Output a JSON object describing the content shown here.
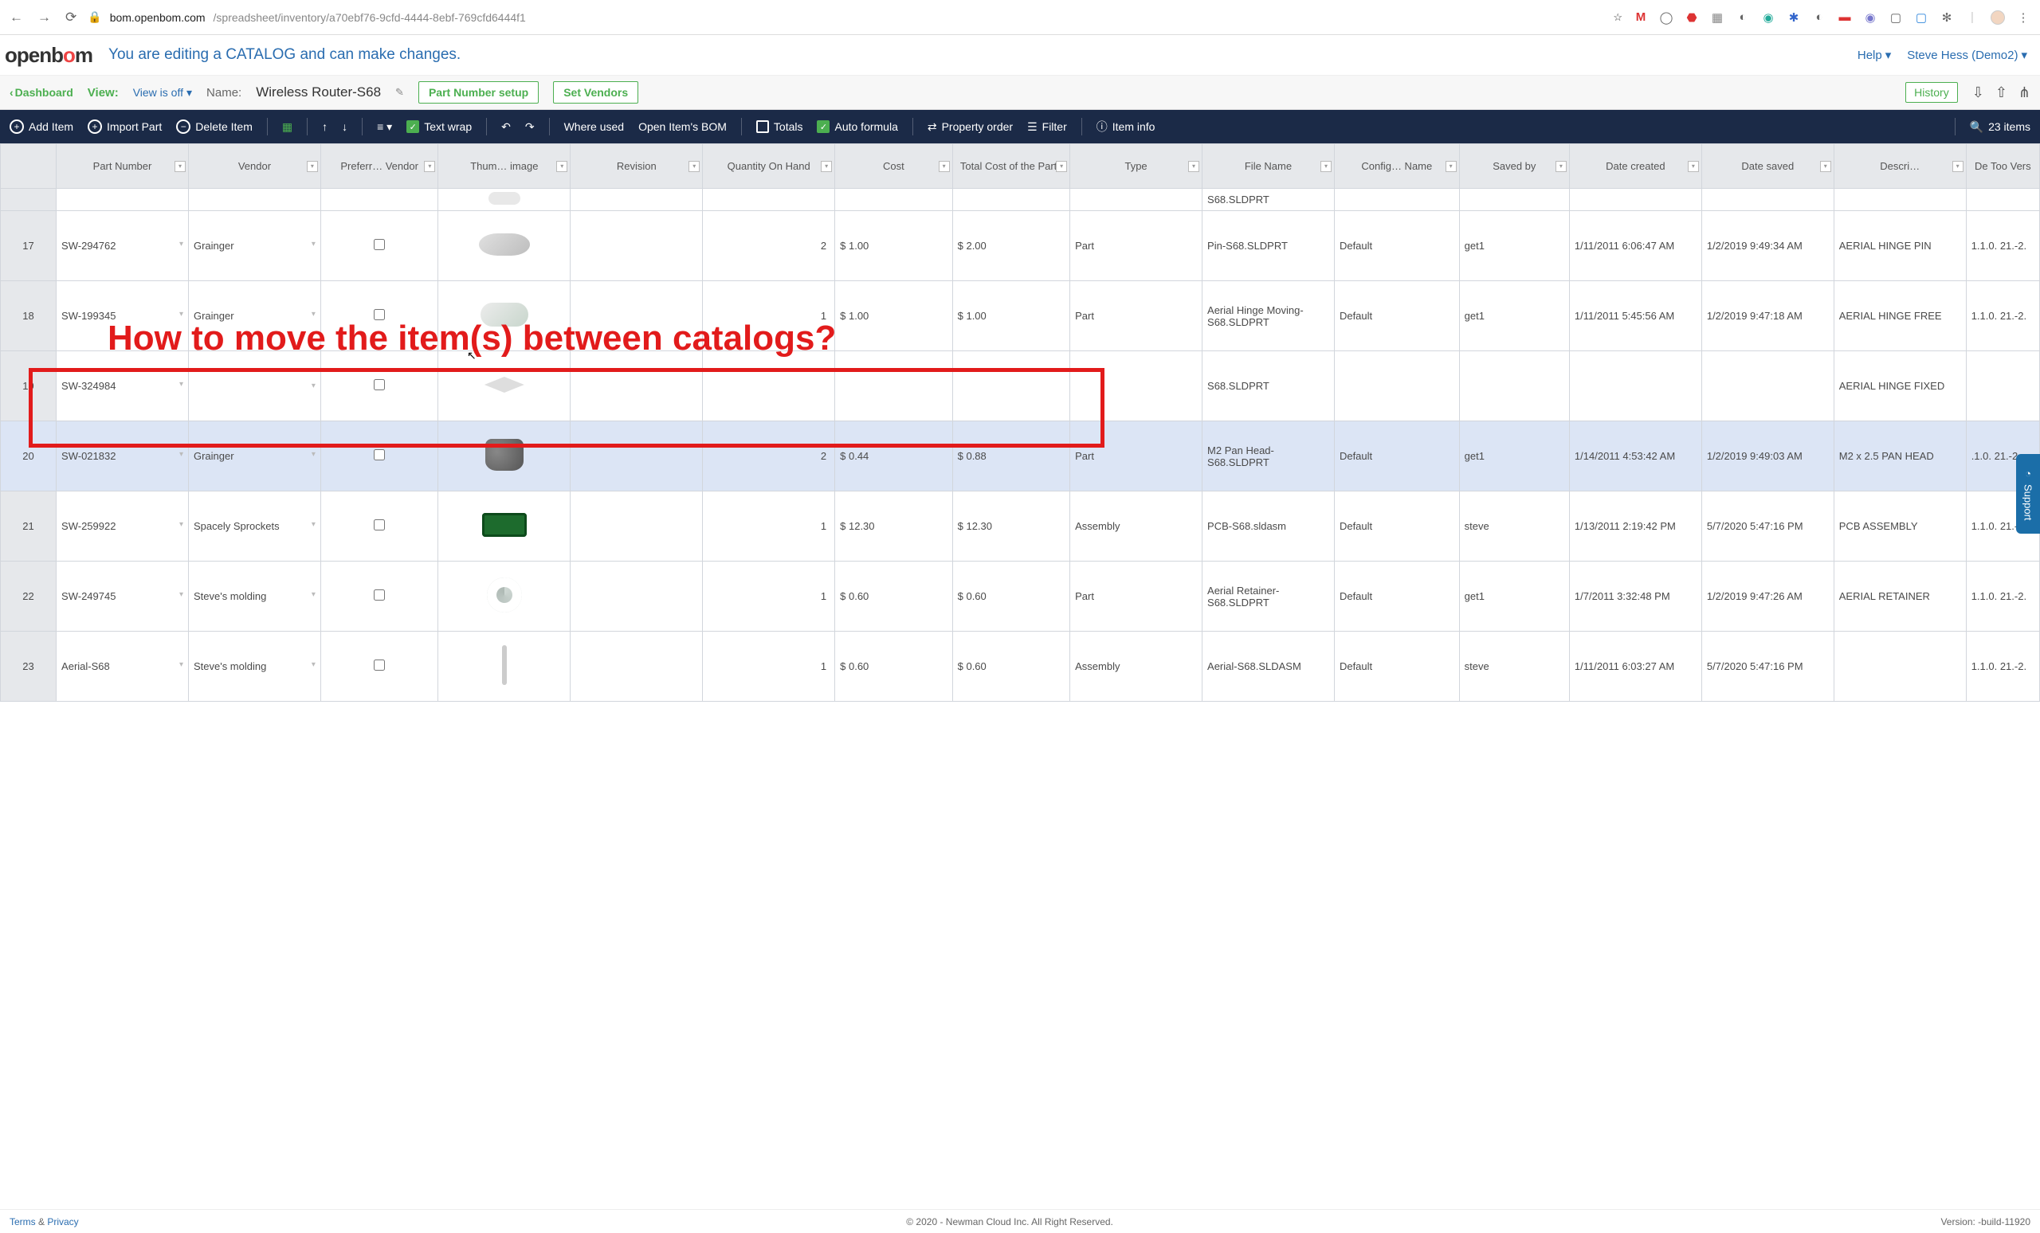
{
  "browser": {
    "url_host": "bom.openbom.com",
    "url_path": "/spreadsheet/inventory/a70ebf76-9cfd-4444-8ebf-769cfd6444f1"
  },
  "logo_text_a": "openb",
  "logo_text_b": "o",
  "logo_text_c": "m",
  "catalog_message": "You are editing a CATALOG and can make changes.",
  "help_label": "Help",
  "user_label": "Steve Hess (Demo2)",
  "subheader": {
    "dashboard": "Dashboard",
    "view_label": "View:",
    "view_value": "View is off",
    "name_label": "Name:",
    "name_value": "Wireless Router-S68",
    "part_number_setup": "Part Number setup",
    "set_vendors": "Set Vendors",
    "history": "History"
  },
  "toolbar": {
    "add_item": "Add Item",
    "import_part": "Import Part",
    "delete_item": "Delete Item",
    "text_wrap": "Text wrap",
    "where_used": "Where used",
    "open_bom": "Open Item's BOM",
    "totals": "Totals",
    "auto_formula": "Auto formula",
    "property_order": "Property order",
    "filter": "Filter",
    "item_info": "Item info",
    "item_count": "23 items"
  },
  "columns": [
    "Part Number",
    "Vendor",
    "Preferr… Vendor",
    "Thum… image",
    "Revision",
    "Quantity On Hand",
    "Cost",
    "Total Cost of the Parts",
    "Type",
    "File Name",
    "Config… Name",
    "Saved by",
    "Date created",
    "Date saved",
    "Descri…",
    "De Too Vers"
  ],
  "rows": [
    {
      "num": "17",
      "part": "SW-294762",
      "vendor": "Grainger",
      "qty": "2",
      "cost": "$ 1.00",
      "total": "$ 2.00",
      "type": "Part",
      "file": "Pin-S68.SLDPRT",
      "config": "Default",
      "saved_by": "get1",
      "created": "1/11/2011 6:06:47 AM",
      "saved": "1/2/2019 9:49:34 AM",
      "desc": "AERIAL HINGE PIN",
      "ver": "1.1.0. 21.-2.",
      "thumb": "cylinder"
    },
    {
      "num": "18",
      "part": "SW-199345",
      "vendor": "Grainger",
      "qty": "1",
      "cost": "$ 1.00",
      "total": "$ 1.00",
      "type": "Part",
      "file": "Aerial Hinge Moving-S68.SLDPRT",
      "config": "Default",
      "saved_by": "get1",
      "created": "1/11/2011 5:45:56 AM",
      "saved": "1/2/2019 9:47:18 AM",
      "desc": "AERIAL HINGE FREE",
      "ver": "1.1.0. 21.-2.",
      "thumb": "hinge"
    },
    {
      "num": "19",
      "part": "SW-324984",
      "vendor": "",
      "qty": "",
      "cost": "",
      "total": "",
      "type": "",
      "file": "S68.SLDPRT",
      "config": "",
      "saved_by": "",
      "created": "",
      "saved": "",
      "desc": "AERIAL HINGE FIXED",
      "ver": "",
      "thumb": "bracket"
    },
    {
      "num": "20",
      "part": "SW-021832",
      "vendor": "Grainger",
      "qty": "2",
      "cost": "$ 0.44",
      "total": "$ 0.88",
      "type": "Part",
      "file": "M2 Pan Head-S68.SLDPRT",
      "config": "Default",
      "saved_by": "get1",
      "created": "1/14/2011 4:53:42 AM",
      "saved": "1/2/2019 9:49:03 AM",
      "desc": "M2 x 2.5 PAN HEAD",
      "ver": ".1.0. 21.-2.",
      "thumb": "screw",
      "selected": true
    },
    {
      "num": "21",
      "part": "SW-259922",
      "vendor": "Spacely Sprockets",
      "qty": "1",
      "cost": "$ 12.30",
      "total": "$ 12.30",
      "type": "Assembly",
      "file": "PCB-S68.sldasm",
      "config": "Default",
      "saved_by": "steve",
      "created": "1/13/2011 2:19:42 PM",
      "saved": "5/7/2020 5:47:16 PM",
      "desc": "PCB ASSEMBLY",
      "ver": "1.1.0. 21.-2.",
      "thumb": "pcb"
    },
    {
      "num": "22",
      "part": "SW-249745",
      "vendor": "Steve's molding",
      "qty": "1",
      "cost": "$ 0.60",
      "total": "$ 0.60",
      "type": "Part",
      "file": "Aerial Retainer-S68.SLDPRT",
      "config": "Default",
      "saved_by": "get1",
      "created": "1/7/2011 3:32:48 PM",
      "saved": "1/2/2019 9:47:26 AM",
      "desc": "AERIAL RETAINER",
      "ver": "1.1.0. 21.-2.",
      "thumb": "ring"
    },
    {
      "num": "23",
      "part": "Aerial-S68",
      "vendor": "Steve's molding",
      "qty": "1",
      "cost": "$ 0.60",
      "total": "$ 0.60",
      "type": "Assembly",
      "file": "Aerial-S68.SLDASM",
      "config": "Default",
      "saved_by": "steve",
      "created": "1/11/2011 6:03:27 AM",
      "saved": "5/7/2020 5:47:16 PM",
      "desc": "",
      "ver": "1.1.0. 21.-2.",
      "thumb": "post"
    }
  ],
  "partial_row_file": "S68.SLDPRT",
  "annotation": "How to move the item(s) between catalogs?",
  "support_label": "Support",
  "footer": {
    "terms": "Terms",
    "and": " & ",
    "privacy": "Privacy",
    "copyright": "© 2020 - Newman Cloud Inc. All Right Reserved.",
    "version": "Version: -build-11920"
  }
}
